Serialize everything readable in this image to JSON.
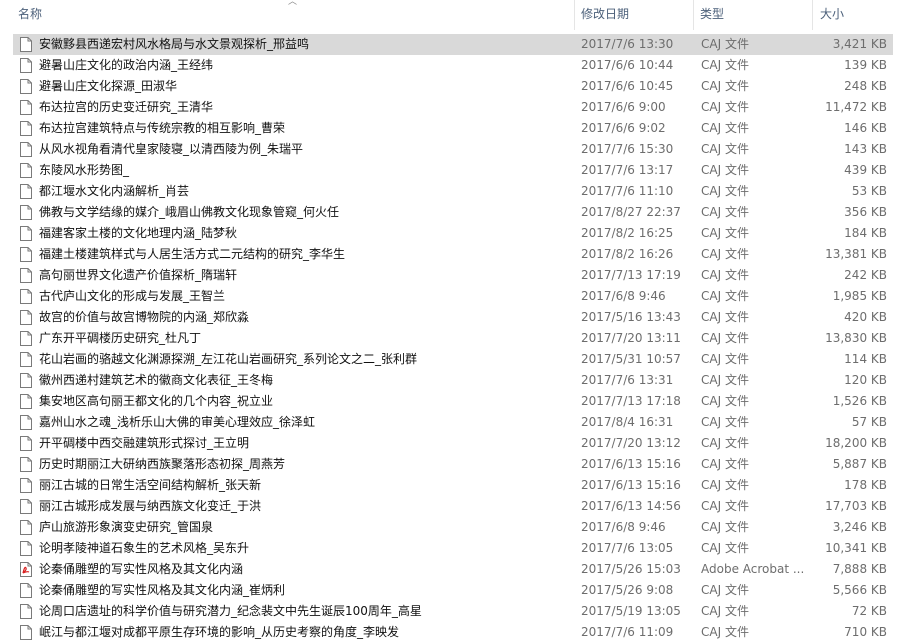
{
  "columns": {
    "name": "名称",
    "date": "修改日期",
    "type": "类型",
    "size": "大小"
  },
  "files": [
    {
      "name": "安徽黟县西递宏村风水格局与水文景观探析_邢益鸣",
      "date": "2017/7/6 13:30",
      "type": "CAJ 文件",
      "size": "3,421 KB",
      "icon": "document-icon",
      "selected": true
    },
    {
      "name": "避暑山庄文化的政治内涵_王经纬",
      "date": "2017/6/6 10:44",
      "type": "CAJ 文件",
      "size": "139 KB",
      "icon": "document-icon"
    },
    {
      "name": "避暑山庄文化探源_田淑华",
      "date": "2017/6/6 10:45",
      "type": "CAJ 文件",
      "size": "248 KB",
      "icon": "document-icon"
    },
    {
      "name": "布达拉宫的历史变迁研究_王清华",
      "date": "2017/6/6 9:00",
      "type": "CAJ 文件",
      "size": "11,472 KB",
      "icon": "document-icon"
    },
    {
      "name": "布达拉宫建筑特点与传统宗教的相互影响_曹荣",
      "date": "2017/6/6 9:02",
      "type": "CAJ 文件",
      "size": "146 KB",
      "icon": "document-icon"
    },
    {
      "name": "从风水视角看清代皇家陵寝_以清西陵为例_朱瑞平",
      "date": "2017/7/6 15:30",
      "type": "CAJ 文件",
      "size": "143 KB",
      "icon": "document-icon"
    },
    {
      "name": "东陵风水形势图_",
      "date": "2017/7/6 13:17",
      "type": "CAJ 文件",
      "size": "439 KB",
      "icon": "document-icon"
    },
    {
      "name": "都江堰水文化内涵解析_肖芸",
      "date": "2017/7/6 11:10",
      "type": "CAJ 文件",
      "size": "53 KB",
      "icon": "document-icon"
    },
    {
      "name": "佛教与文学结缘的媒介_峨眉山佛教文化现象管窥_何火任",
      "date": "2017/8/27 22:37",
      "type": "CAJ 文件",
      "size": "356 KB",
      "icon": "document-icon"
    },
    {
      "name": "福建客家土楼的文化地理内涵_陆梦秋",
      "date": "2017/8/2 16:25",
      "type": "CAJ 文件",
      "size": "184 KB",
      "icon": "document-icon"
    },
    {
      "name": "福建土楼建筑样式与人居生活方式二元结构的研究_李华生",
      "date": "2017/8/2 16:26",
      "type": "CAJ 文件",
      "size": "13,381 KB",
      "icon": "document-icon"
    },
    {
      "name": "高句丽世界文化遗产价值探析_隋瑞轩",
      "date": "2017/7/13 17:19",
      "type": "CAJ 文件",
      "size": "242 KB",
      "icon": "document-icon"
    },
    {
      "name": "古代庐山文化的形成与发展_王智兰",
      "date": "2017/6/8 9:46",
      "type": "CAJ 文件",
      "size": "1,985 KB",
      "icon": "document-icon"
    },
    {
      "name": "故宫的价值与故宫博物院的内涵_郑欣淼",
      "date": "2017/5/16 13:43",
      "type": "CAJ 文件",
      "size": "420 KB",
      "icon": "document-icon"
    },
    {
      "name": "广东开平碉楼历史研究_杜凡丁",
      "date": "2017/7/20 13:11",
      "type": "CAJ 文件",
      "size": "13,830 KB",
      "icon": "document-icon"
    },
    {
      "name": "花山岩画的骆越文化渊源探溯_左江花山岩画研究_系列论文之二_张利群",
      "date": "2017/5/31 10:57",
      "type": "CAJ 文件",
      "size": "114 KB",
      "icon": "document-icon"
    },
    {
      "name": "徽州西递村建筑艺术的徽商文化表征_王冬梅",
      "date": "2017/7/6 13:31",
      "type": "CAJ 文件",
      "size": "120 KB",
      "icon": "document-icon"
    },
    {
      "name": "集安地区高句丽王都文化的几个内容_祝立业",
      "date": "2017/7/13 17:18",
      "type": "CAJ 文件",
      "size": "1,526 KB",
      "icon": "document-icon"
    },
    {
      "name": "嘉州山水之魂_浅析乐山大佛的审美心理效应_徐泽虹",
      "date": "2017/8/4 16:31",
      "type": "CAJ 文件",
      "size": "57 KB",
      "icon": "document-icon"
    },
    {
      "name": "开平碉楼中西交融建筑形式探讨_王立明",
      "date": "2017/7/20 13:12",
      "type": "CAJ 文件",
      "size": "18,200 KB",
      "icon": "document-icon"
    },
    {
      "name": "历史时期丽江大研纳西族聚落形态初探_周燕芳",
      "date": "2017/6/13 15:16",
      "type": "CAJ 文件",
      "size": "5,887 KB",
      "icon": "document-icon"
    },
    {
      "name": "丽江古城的日常生活空间结构解析_张天新",
      "date": "2017/6/13 15:16",
      "type": "CAJ 文件",
      "size": "178 KB",
      "icon": "document-icon"
    },
    {
      "name": "丽江古城形成发展与纳西族文化变迁_于洪",
      "date": "2017/6/13 14:56",
      "type": "CAJ 文件",
      "size": "17,703 KB",
      "icon": "document-icon"
    },
    {
      "name": "庐山旅游形象演变史研究_管国泉",
      "date": "2017/6/8 9:46",
      "type": "CAJ 文件",
      "size": "3,246 KB",
      "icon": "document-icon"
    },
    {
      "name": "论明孝陵神道石象生的艺术风格_吴东升",
      "date": "2017/7/6 13:05",
      "type": "CAJ 文件",
      "size": "10,341 KB",
      "icon": "document-icon"
    },
    {
      "name": "论秦俑雕塑的写实性风格及其文化内涵",
      "date": "2017/5/26 15:03",
      "type": "Adobe Acrobat ...",
      "size": "7,888 KB",
      "icon": "pdf-icon"
    },
    {
      "name": "论秦俑雕塑的写实性风格及其文化内涵_崔炳利",
      "date": "2017/5/26 9:08",
      "type": "CAJ 文件",
      "size": "5,566 KB",
      "icon": "document-icon"
    },
    {
      "name": "论周口店遗址的科学价值与研究潜力_纪念裴文中先生诞辰100周年_高星",
      "date": "2017/5/19 13:05",
      "type": "CAJ 文件",
      "size": "72 KB",
      "icon": "document-icon"
    },
    {
      "name": "岷江与都江堰对成都平原生存环境的影响_从历史考察的角度_李映发",
      "date": "2017/7/6 11:09",
      "type": "CAJ 文件",
      "size": "710 KB",
      "icon": "document-icon"
    }
  ]
}
